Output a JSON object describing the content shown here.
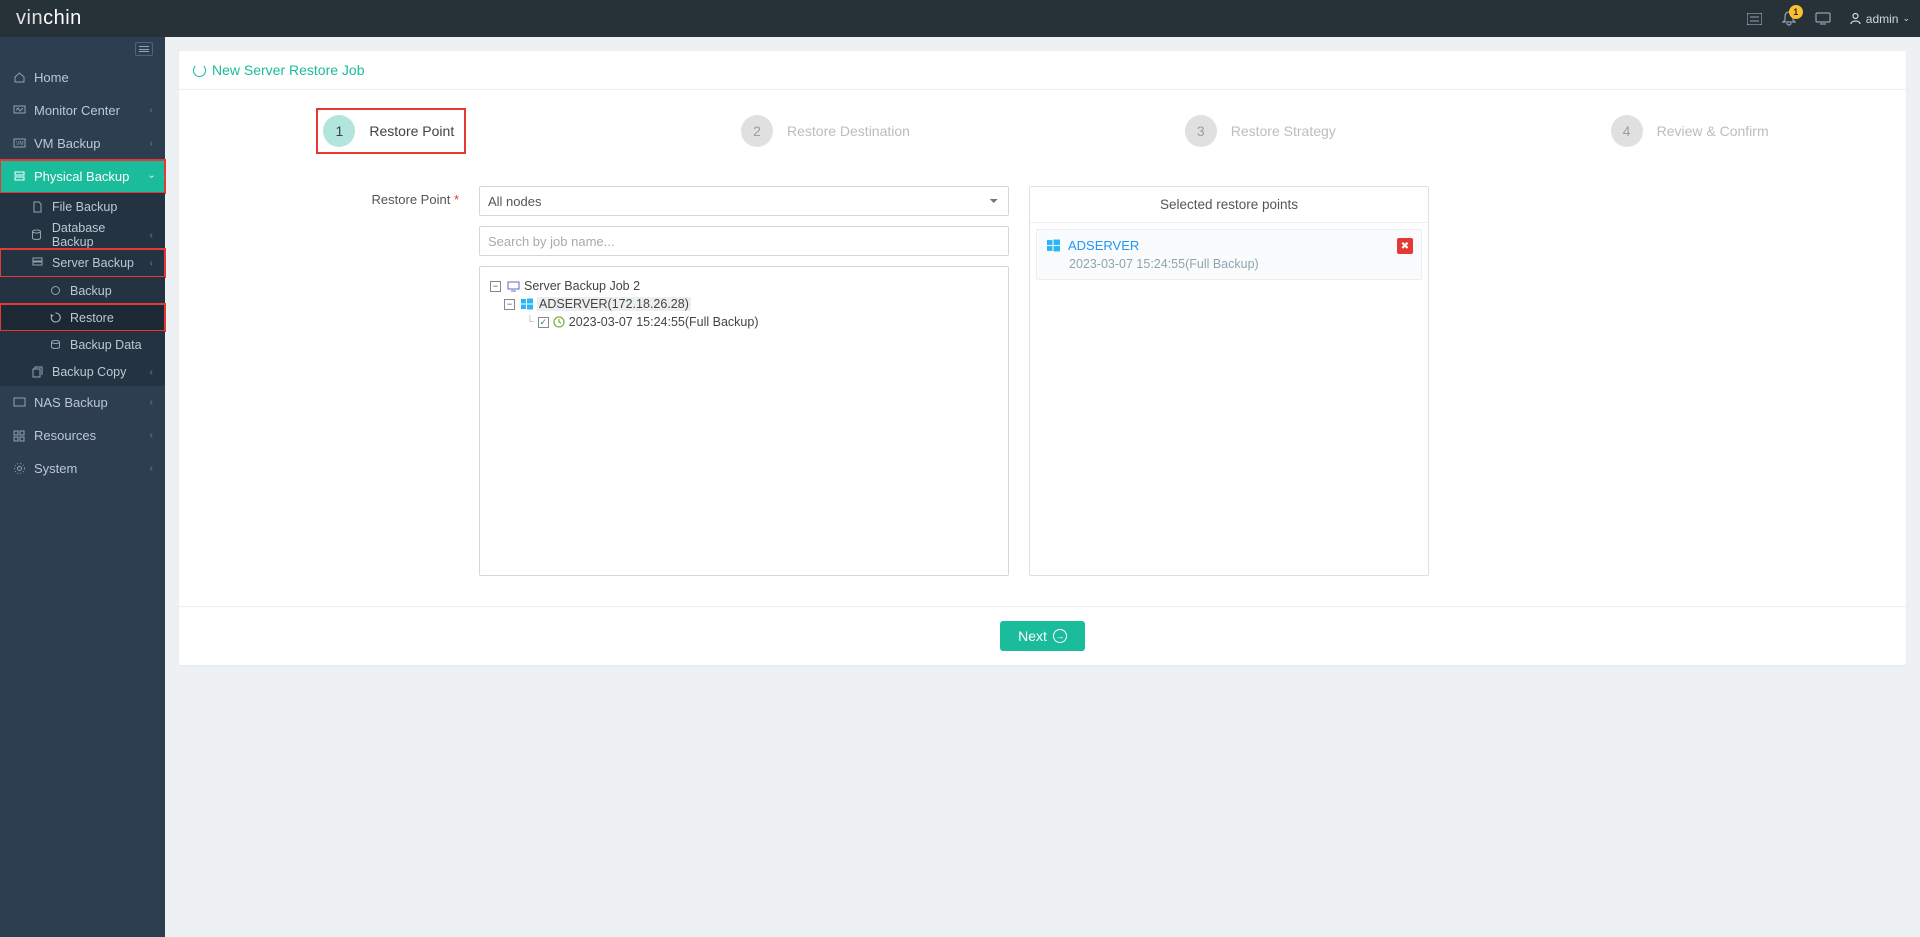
{
  "brand": {
    "a": "vin",
    "b": "chin"
  },
  "header": {
    "notif_count": "1",
    "user": "admin"
  },
  "sidebar": {
    "items": [
      {
        "label": "Home"
      },
      {
        "label": "Monitor Center"
      },
      {
        "label": "VM Backup"
      },
      {
        "label": "Physical Backup"
      },
      {
        "label": "NAS Backup"
      },
      {
        "label": "Resources"
      },
      {
        "label": "System"
      },
      {
        "label": "Backup Copy"
      }
    ],
    "physical_sub": [
      {
        "label": "File Backup"
      },
      {
        "label": "Database Backup"
      },
      {
        "label": "Server Backup"
      }
    ],
    "server_sub": [
      {
        "label": "Backup"
      },
      {
        "label": "Restore"
      },
      {
        "label": "Backup Data"
      }
    ]
  },
  "page": {
    "title": "New Server Restore Job"
  },
  "wizard": {
    "steps": [
      {
        "num": "1",
        "label": "Restore Point"
      },
      {
        "num": "2",
        "label": "Restore Destination"
      },
      {
        "num": "3",
        "label": "Restore Strategy"
      },
      {
        "num": "4",
        "label": "Review & Confirm"
      }
    ]
  },
  "form": {
    "label": "Restore Point",
    "node_select": "All nodes",
    "search_placeholder": "Search by job name...",
    "tree": {
      "job": "Server Backup Job 2",
      "server": "ADSERVER(172.18.26.28)",
      "point": "2023-03-07 15:24:55(Full  Backup)"
    }
  },
  "selected": {
    "title": "Selected restore points",
    "item_name": "ADSERVER",
    "item_detail": "2023-03-07 15:24:55(Full Backup)"
  },
  "next": "Next"
}
